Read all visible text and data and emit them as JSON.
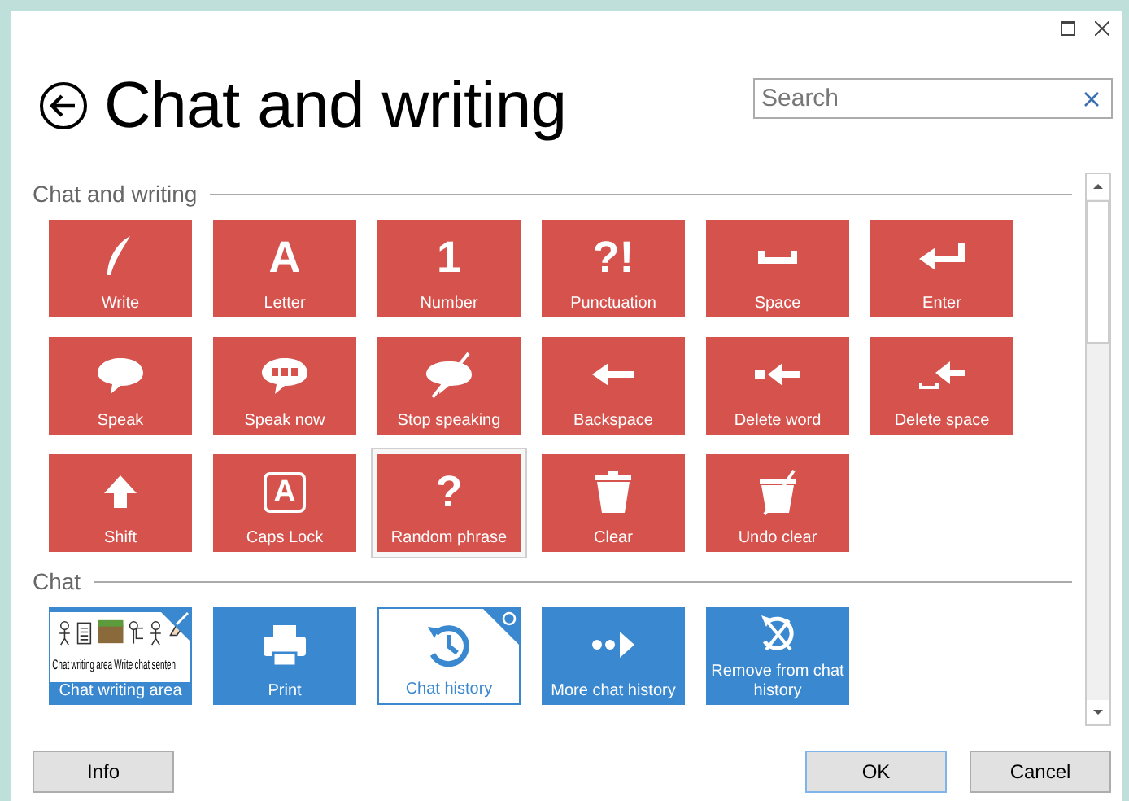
{
  "title": "Chat and writing",
  "search": {
    "placeholder": "Search"
  },
  "sections": [
    {
      "heading": "Chat and writing",
      "tiles": [
        {
          "label": "Write",
          "kind": "red",
          "selected": false
        },
        {
          "label": "Letter",
          "kind": "red",
          "glyph": "A",
          "boxed": false,
          "selected": false
        },
        {
          "label": "Number",
          "kind": "red",
          "glyph": "1",
          "boxed": false,
          "selected": false
        },
        {
          "label": "Punctuation",
          "kind": "red",
          "glyph": "?!",
          "boxed": false,
          "selected": false
        },
        {
          "label": "Space",
          "kind": "red",
          "selected": false
        },
        {
          "label": "Enter",
          "kind": "red",
          "selected": false
        },
        {
          "label": "Speak",
          "kind": "red",
          "selected": false
        },
        {
          "label": "Speak now",
          "kind": "red",
          "selected": false
        },
        {
          "label": "Stop speaking",
          "kind": "red",
          "selected": false
        },
        {
          "label": "Backspace",
          "kind": "red",
          "selected": false
        },
        {
          "label": "Delete word",
          "kind": "red",
          "selected": false
        },
        {
          "label": "Delete space",
          "kind": "red",
          "selected": false
        },
        {
          "label": "Shift",
          "kind": "red",
          "selected": false
        },
        {
          "label": "Caps Lock",
          "kind": "red",
          "glyph": "A",
          "boxed": true,
          "selected": false
        },
        {
          "label": "Random phrase",
          "kind": "red",
          "glyph": "?",
          "boxed": false,
          "selected": true
        },
        {
          "label": "Clear",
          "kind": "red",
          "selected": false
        },
        {
          "label": "Undo clear",
          "kind": "red",
          "selected": false
        }
      ]
    },
    {
      "heading": "Chat",
      "tiles": [
        {
          "label": "Chat writing area",
          "kind": "preview",
          "words": [
            "Chat",
            "writing",
            "area",
            "Write",
            "chat",
            "senten"
          ],
          "selected": false
        },
        {
          "label": "Print",
          "kind": "blue",
          "selected": false
        },
        {
          "label": "Chat history",
          "kind": "outline",
          "selected": false
        },
        {
          "label": "More chat history",
          "kind": "blue",
          "selected": false
        },
        {
          "label": "Remove from chat history",
          "kind": "blue",
          "selected": false
        }
      ]
    }
  ],
  "buttons": {
    "left": [
      "Info"
    ],
    "right": [
      "OK",
      "Cancel"
    ]
  }
}
